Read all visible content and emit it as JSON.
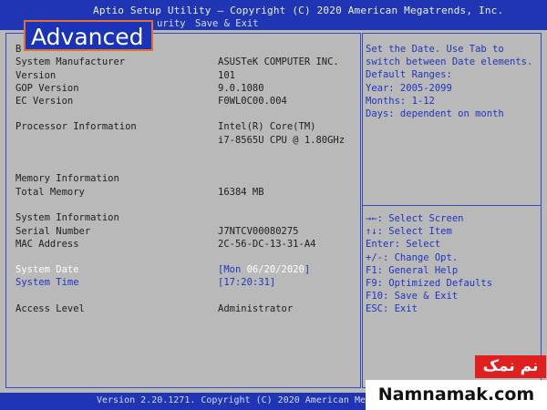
{
  "header": {
    "title": "Aptio Setup Utility – Copyright (C) 2020 American Megatrends, Inc.",
    "menu_fragment": "urity",
    "menu_save_exit": "Save & Exit",
    "active_tab": "Advanced"
  },
  "main": {
    "section_letter": "B",
    "rows": [
      {
        "label": "System Manufacturer",
        "value": "ASUSTeK COMPUTER INC."
      },
      {
        "label": "Version",
        "value": "101"
      },
      {
        "label": "GOP Version",
        "value": "9.0.1080"
      },
      {
        "label": "EC Version",
        "value": "F0WL0C00.004"
      },
      {
        "label": "Processor Information",
        "value": "Intel(R) Core(TM)"
      },
      {
        "label": "",
        "value": "i7-8565U CPU @ 1.80GHz"
      },
      {
        "label": "Memory Information",
        "value": ""
      },
      {
        "label": "Total Memory",
        "value": "16384 MB"
      },
      {
        "label": "System Information",
        "value": ""
      },
      {
        "label": "Serial Number",
        "value": "J7NTCV00080275"
      },
      {
        "label": "MAC Address",
        "value": "2C-56-DC-13-31-A4"
      }
    ],
    "system_date": {
      "label": "System Date",
      "open": "[",
      "day": "Mon",
      "date": "06/20/2020",
      "close": "]"
    },
    "system_time": {
      "label": "System Time",
      "value": "[17:20:31]"
    },
    "access_level": {
      "label": "Access Level",
      "value": "Administrator"
    }
  },
  "help": {
    "description": [
      "Set the Date. Use Tab to",
      "switch between Date elements.",
      "Default Ranges:",
      "Year: 2005-2099",
      "Months: 1-12",
      "Days: dependent on month"
    ],
    "keys": [
      "→←: Select Screen",
      "↑↓: Select Item",
      "Enter: Select",
      "+/-: Change Opt.",
      "F1: General Help",
      "F9: Optimized Defaults",
      "F10: Save & Exit",
      "ESC: Exit"
    ]
  },
  "footer": {
    "text": "Version 2.20.1271. Copyright (C) 2020 American Me"
  },
  "watermark": {
    "persian": "نم نمک",
    "site": "Namnamak.com"
  },
  "colors": {
    "bios_blue": "#1f35b4",
    "panel_gray": "#b9b9b9",
    "highlight_orange": "#e0702c",
    "watermark_red": "#e01f1f"
  }
}
